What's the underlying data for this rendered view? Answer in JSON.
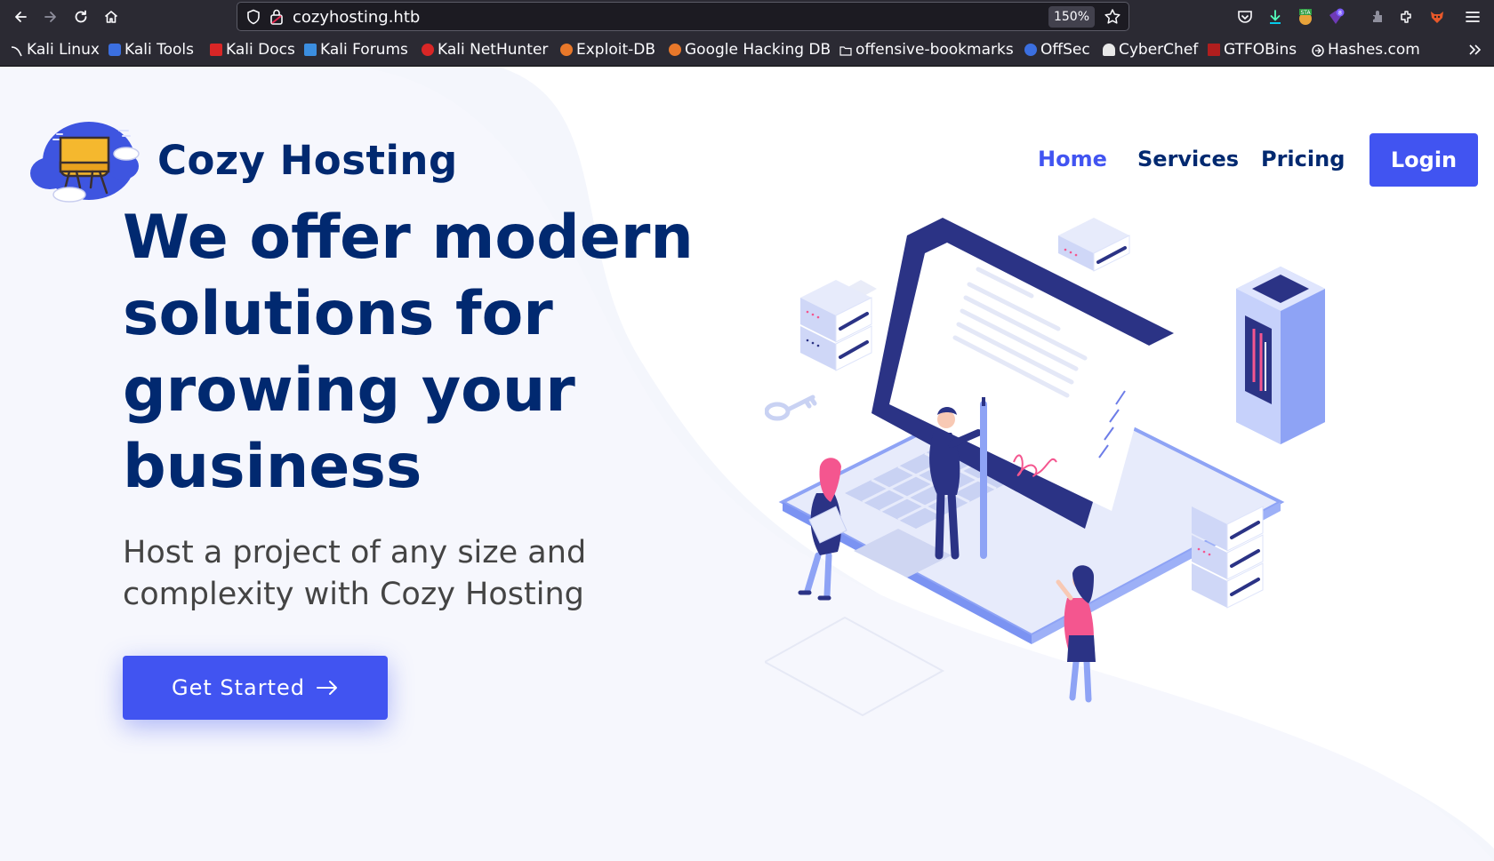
{
  "browser": {
    "url": "cozyhosting.htb",
    "zoom": "150%",
    "bookmarks": [
      "Kali Linux",
      "Kali Tools",
      "Kali Docs",
      "Kali Forums",
      "Kali NetHunter",
      "Exploit-DB",
      "Google Hacking DB",
      "offensive-bookmarks",
      "OffSec",
      "CyberChef",
      "GTFOBins",
      "Hashes.com"
    ],
    "extension_badges": {
      "sta": "STA",
      "count": "8"
    }
  },
  "site": {
    "brand": "Cozy Hosting",
    "nav": {
      "home": "Home",
      "services": "Services",
      "pricing": "Pricing",
      "login": "Login"
    },
    "hero": {
      "title": "We offer modern solutions for growing your business",
      "subtitle": "Host a project of any size and complexity with Cozy Hosting",
      "cta": "Get Started"
    }
  },
  "colors": {
    "primary": "#4154f1",
    "navy": "#012970",
    "text": "#444444",
    "chrome": "#2b2a33",
    "accent_pink": "#f4568f"
  },
  "icons": [
    "back-icon",
    "forward-icon",
    "reload-icon",
    "home-icon",
    "shield-icon",
    "lock-icon",
    "star-icon",
    "pocket-icon",
    "download-icon",
    "extensions-icon",
    "menu-icon",
    "arrow-right-icon",
    "chevrons-right-icon"
  ]
}
